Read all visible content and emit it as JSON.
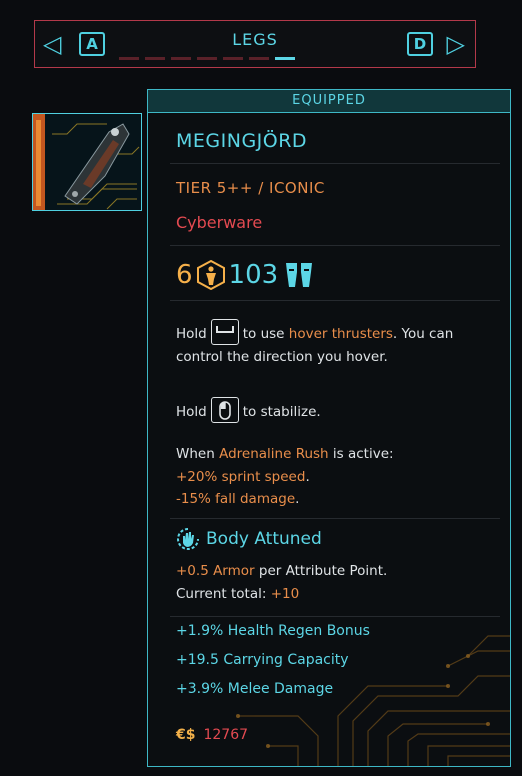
{
  "selector": {
    "title": "LEGS",
    "left_key": "A",
    "right_key": "D",
    "active_index": 6,
    "dash_count": 7
  },
  "item": {
    "status": "EQUIPPED",
    "name": "MEGINGJÖRD",
    "tier": "TIER 5++ / ICONIC",
    "type": "Cyberware",
    "capacity_cost": "6",
    "armor": "103",
    "desc1": {
      "hold": "Hold",
      "to_use": "to use",
      "ability": "hover thrusters",
      "rest": ". You can",
      "line2": "control the direction you hover."
    },
    "desc2": {
      "hold": "Hold",
      "rest": "to stabilize."
    },
    "adrenaline": {
      "when": "When",
      "name": "Adrenaline Rush",
      "is_active": "is active:",
      "bonus1_value": "+20% sprint speed",
      "bonus2_value": "-15% fall damage",
      "period": "."
    },
    "perk": {
      "title": "Body Attuned",
      "value": "+0.5 Armor",
      "rest": "per Attribute Point.",
      "current_label": "Current total:",
      "current_value": "+10"
    },
    "bonuses": [
      "+1.9% Health Regen Bonus",
      "+19.5 Carrying Capacity",
      "+3.9% Melee Damage"
    ],
    "price_currency": "€$",
    "price": "12767"
  },
  "colors": {
    "accent_cyan": "#5cd6e6",
    "accent_red": "#e44a51",
    "accent_orange": "#e98e4b",
    "accent_yellow": "#f6b04a"
  },
  "icons": [
    "arrow-left-icon",
    "arrow-right-icon",
    "attribute-body-icon",
    "legs-armor-icon",
    "jump-key-icon",
    "mouse-icon",
    "body-attuned-icon"
  ]
}
